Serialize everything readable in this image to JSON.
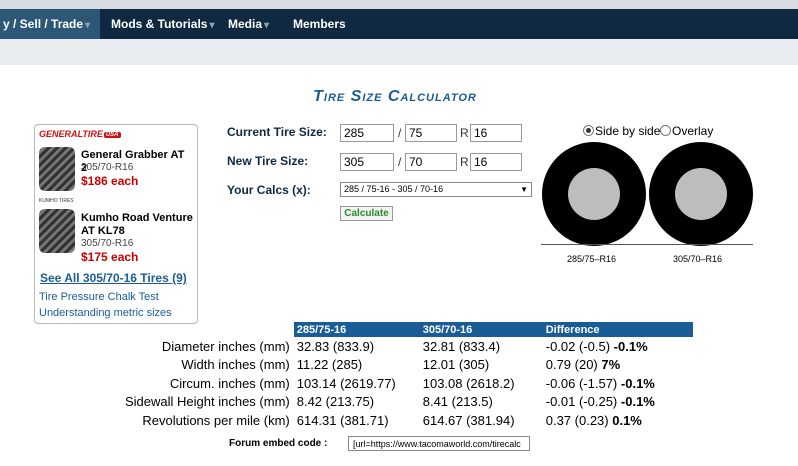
{
  "nav": {
    "items": [
      {
        "label": "y / Sell / Trade",
        "arrow": "▾"
      },
      {
        "label": "Mods & Tutorials",
        "arrow": "▾"
      },
      {
        "label": "Media",
        "arrow": "▾"
      },
      {
        "label": "Members",
        "arrow": ""
      }
    ]
  },
  "title": "Tire Size Calculator",
  "ad": {
    "brand1": "GENERALTIRE",
    "brand1_badge": "USA",
    "products": [
      {
        "name": "General Grabber AT 2",
        "size": "305/70-R16",
        "price": "$186 each"
      },
      {
        "name": "Kumho Road Venture AT KL78",
        "size": "305/70-R16",
        "price": "$175 each"
      }
    ],
    "brand2": "KUMHO TIRES",
    "see_all": "See All 305/70-16 Tires (9)",
    "links": [
      "Tire Pressure Chalk Test",
      "Understanding metric sizes"
    ]
  },
  "form": {
    "current_label": "Current Tire Size:",
    "current": {
      "width": "285",
      "aspect": "75",
      "rim": "16"
    },
    "new_label": "New Tire Size:",
    "new": {
      "width": "305",
      "aspect": "70",
      "rim": "16"
    },
    "sep_slash": "/",
    "sep_r": "R",
    "calcs_label": "Your Calcs (x):",
    "calcs_value": "285 / 75-16 - 305 / 70-16",
    "calculate": "Calculate"
  },
  "view": {
    "options": [
      "Side by side",
      "Overlay"
    ],
    "selected": "Side by side",
    "tire1_label": "285/75–R16",
    "tire2_label": "305/70–R16"
  },
  "results": {
    "headers": [
      "",
      "285/75-16",
      "305/70-16",
      "Difference"
    ],
    "rows": [
      {
        "label": "Diameter inches (mm)",
        "a": "32.83 (833.9)",
        "b": "32.81 (833.4)",
        "diff": "-0.02 (-0.5)",
        "pct": "-0.1%"
      },
      {
        "label": "Width inches (mm)",
        "a": "11.22 (285)",
        "b": "12.01 (305)",
        "diff": "0.79 (20)",
        "pct": "7%"
      },
      {
        "label": "Circum. inches (mm)",
        "a": "103.14 (2619.77)",
        "b": "103.08 (2618.2)",
        "diff": "-0.06 (-1.57)",
        "pct": "-0.1%"
      },
      {
        "label": "Sidewall Height inches (mm)",
        "a": "8.42 (213.75)",
        "b": "8.41 (213.5)",
        "diff": "-0.01 (-0.25)",
        "pct": "-0.1%"
      },
      {
        "label": "Revolutions per mile (km)",
        "a": "614.31 (381.71)",
        "b": "614.67 (381.94)",
        "diff": "0.37 (0.23)",
        "pct": "0.1%"
      }
    ]
  },
  "embed": {
    "label": "Forum embed code",
    "colon": ":",
    "value": "[url=https://www.tacomaworld.com/tirecalc"
  },
  "colors": {
    "nav_bg": "#0f2a40",
    "accent": "#1a5c96",
    "price": "#cc0000",
    "button_text": "#2a8a2a"
  }
}
